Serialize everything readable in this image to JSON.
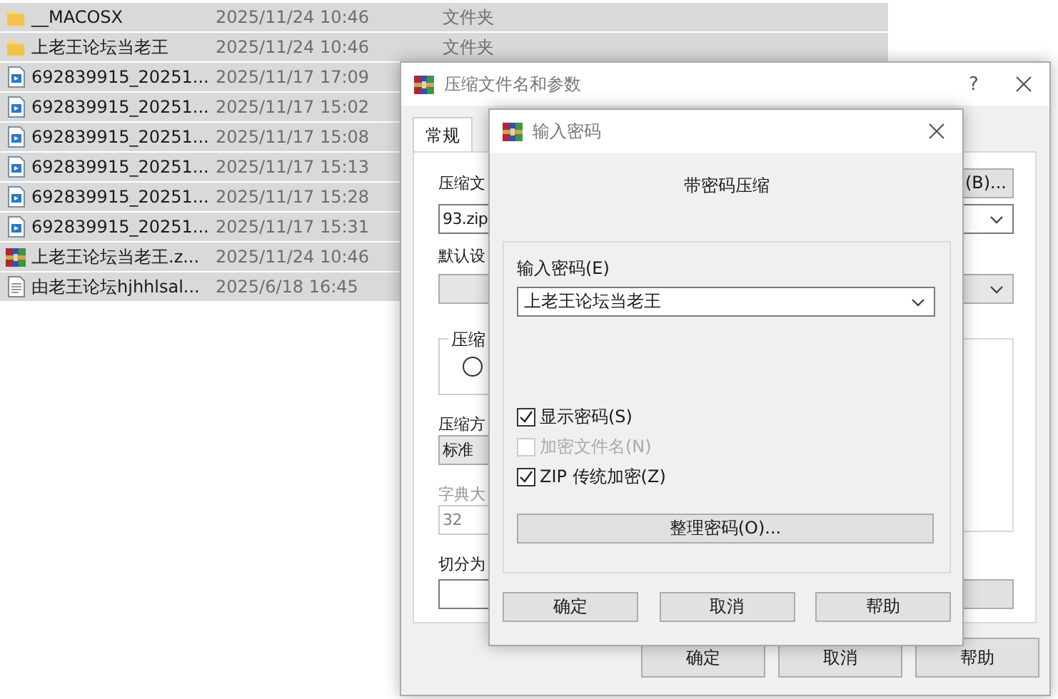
{
  "files": [
    {
      "kind": "folder",
      "name": "__MACOSX",
      "date": "2025/11/24 10:46",
      "type": "文件夹",
      "selected": true
    },
    {
      "kind": "folder",
      "name": "上老王论坛当老王",
      "date": "2025/11/24 10:46",
      "type": "文件夹",
      "selected": true
    },
    {
      "kind": "video",
      "name": "692839915_20251...",
      "date": "2025/11/17 17:09",
      "selected": true
    },
    {
      "kind": "video",
      "name": "692839915_20251...",
      "date": "2025/11/17 15:02",
      "selected": true
    },
    {
      "kind": "video",
      "name": "692839915_20251...",
      "date": "2025/11/17 15:08",
      "selected": true
    },
    {
      "kind": "video",
      "name": "692839915_20251...",
      "date": "2025/11/17 15:13",
      "selected": true
    },
    {
      "kind": "video",
      "name": "692839915_20251...",
      "date": "2025/11/17 15:28",
      "selected": true
    },
    {
      "kind": "video",
      "name": "692839915_20251...",
      "date": "2025/11/17 15:31",
      "selected": true
    },
    {
      "kind": "archive",
      "name": "上老王论坛当老王.z...",
      "date": "2025/11/24 10:46",
      "selected": true
    },
    {
      "kind": "text",
      "name": "由老王论坛hjhhlsal...",
      "date": "2025/6/18 16:45",
      "selected": true
    }
  ],
  "archive_dialog": {
    "title": "压缩文件名和参数",
    "help_button": "?",
    "tabs": [
      {
        "label": "常规",
        "selected": true
      }
    ],
    "archive_name": {
      "label": "压缩文",
      "browse_button": "(B)...",
      "value": "93.zip"
    },
    "profile": {
      "label": "默认设"
    },
    "format_group": {
      "label": "压缩",
      "radio": {
        "selected": false
      }
    },
    "method": {
      "label": "压缩方",
      "value": "标准"
    },
    "dictionary": {
      "label": "字典大",
      "value": "32",
      "disabled": true
    },
    "split": {
      "label": "切分为"
    },
    "buttons": [
      "确定",
      "取消",
      "帮助"
    ]
  },
  "password_dialog": {
    "title": "输入密码",
    "heading": "带密码压缩",
    "password": {
      "label": "输入密码(E)",
      "value": "上老王论坛当老王"
    },
    "options": [
      {
        "label": "显示密码(S)",
        "checked": true,
        "disabled": false
      },
      {
        "label": "加密文件名(N)",
        "checked": false,
        "disabled": true
      },
      {
        "label": "ZIP 传统加密(Z)",
        "checked": true,
        "disabled": false
      }
    ],
    "organize_button": "整理密码(O)...",
    "buttons": [
      "确定",
      "取消",
      "帮助"
    ]
  }
}
